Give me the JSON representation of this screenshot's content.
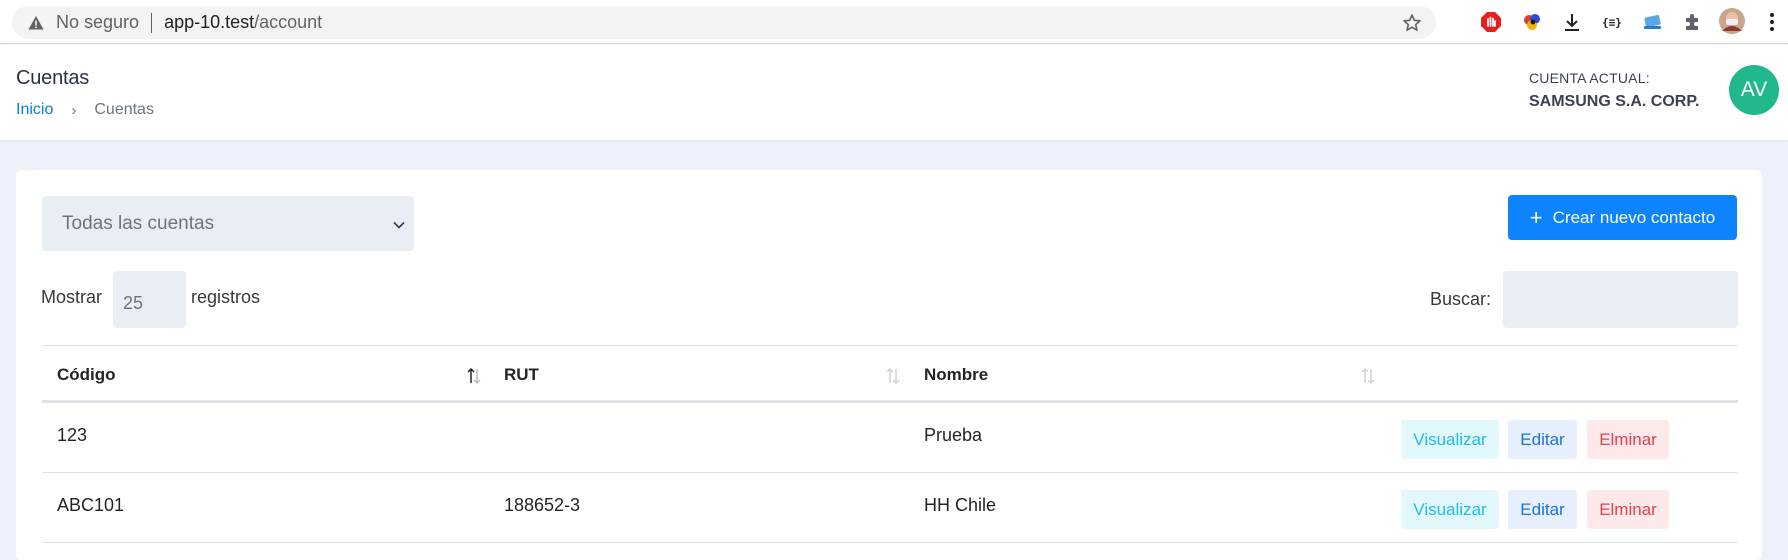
{
  "browser": {
    "security_label": "No seguro",
    "url_host": "app-10.test",
    "url_path": "/account"
  },
  "header": {
    "title": "Cuentas",
    "breadcrumb": {
      "home": "Inicio",
      "separator": "›",
      "current": "Cuentas"
    },
    "account_label": "CUENTA ACTUAL:",
    "account_name": "SAMSUNG S.A. CORP.",
    "avatar_initials": "AV"
  },
  "toolbar": {
    "filter_selected": "Todas las cuentas",
    "create_label": "Crear nuevo contacto",
    "create_icon": "+",
    "show_label": "Mostrar",
    "page_size": "25",
    "records_label": "registros",
    "search_label": "Buscar:"
  },
  "table": {
    "columns": [
      "Código",
      "RUT",
      "Nombre"
    ],
    "rows": [
      {
        "codigo": "123",
        "rut": "",
        "nombre": "Prueba"
      },
      {
        "codigo": "ABC101",
        "rut": "188652-3",
        "nombre": "HH Chile"
      }
    ],
    "actions": {
      "view": "Visualizar",
      "edit": "Editar",
      "delete": "Elminar"
    }
  },
  "colors": {
    "primary": "#0d83fd",
    "avatar": "#21b88e",
    "link": "#0b7be0",
    "view": "#1dbfe0",
    "edit": "#1a73d9",
    "delete": "#e0414f"
  }
}
